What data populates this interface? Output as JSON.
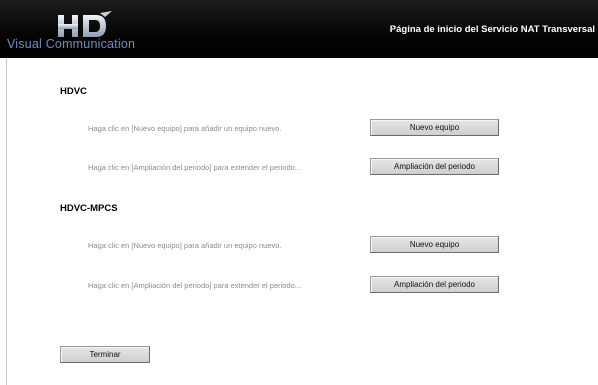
{
  "header": {
    "logo_text": "Visual Communication",
    "logo_mark": "HD",
    "title": "Página de inicio del Servicio NAT Transversal"
  },
  "sections": [
    {
      "title": "HDVC",
      "rows": [
        {
          "text": "Haga clic en [Nuevo equipo] para añadir un equipo nuevo.",
          "button": "Nuevo equipo"
        },
        {
          "text": "Haga clic en [Ampliación del periodo] para extender el periodo...",
          "button": "Ampliación del periodo"
        }
      ]
    },
    {
      "title": "HDVC-MPCS",
      "rows": [
        {
          "text": "Haga clic en [Nuevo equipo] para añadir un equipo nuevo.",
          "button": "Nuevo equipo"
        },
        {
          "text": "Haga clic en [Ampliación del periodo] para extender el periodo...",
          "button": "Ampliación del periodo"
        }
      ]
    }
  ],
  "finish_button": "Terminar"
}
